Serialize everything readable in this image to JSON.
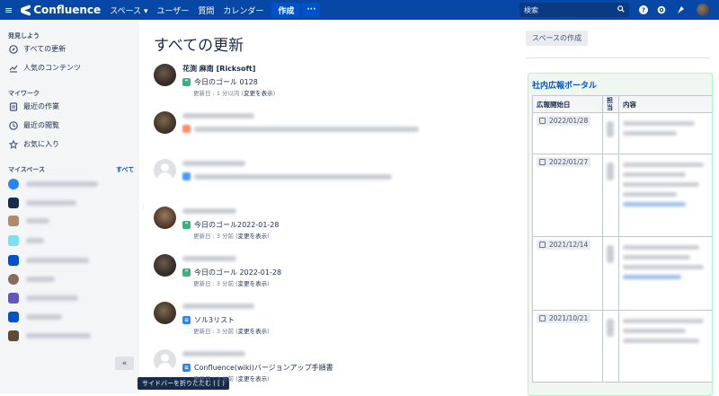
{
  "topbar": {
    "menu_icon": "hamburger-icon",
    "app_name": "Confluence",
    "nav": [
      {
        "label": "スペース ▾"
      },
      {
        "label": "ユーザー"
      },
      {
        "label": "質問"
      },
      {
        "label": "カレンダー"
      }
    ],
    "create_label": "作成",
    "more_label": "···",
    "search_placeholder": "検索",
    "icons": [
      "help-icon",
      "settings-icon",
      "notifications-icon"
    ]
  },
  "sidebar": {
    "discover_heading": "発見しよう",
    "discover_items": [
      {
        "label": "すべての更新",
        "icon": "compass-icon"
      },
      {
        "label": "人気のコンテンツ",
        "icon": "chart-icon"
      }
    ],
    "mywork_heading": "マイワーク",
    "mywork_items": [
      {
        "label": "最近の作業",
        "icon": "document-icon"
      },
      {
        "label": "最近の閲覧",
        "icon": "clock-icon"
      },
      {
        "label": "お気に入り",
        "icon": "star-icon"
      }
    ],
    "myspaces_heading": "マイスペース",
    "all_link": "すべて",
    "collapse_label": "«",
    "collapse_tooltip": "サイドバーを折りたたむ ( [ )"
  },
  "main": {
    "title": "すべての更新",
    "feed": [
      {
        "author": "花渕 麻南 [Ricksoft]",
        "title": "今日のゴール 0128",
        "meta_prefix": "更新日 : 1 分以内 (",
        "meta_link": "変更を表示",
        "meta_suffix": ")",
        "type": "quote"
      },
      {
        "author": "",
        "title": "",
        "meta_prefix": "",
        "meta_link": "",
        "meta_suffix": "",
        "type": "blur"
      },
      {
        "author": "",
        "title": "",
        "meta_prefix": "",
        "meta_link": "",
        "meta_suffix": "",
        "type": "blueblur"
      },
      {
        "author": "",
        "title": "今日のゴール2022-01-28",
        "meta_prefix": "更新日 : 3 分前 (",
        "meta_link": "変更を表示",
        "meta_suffix": ")",
        "type": "quote"
      },
      {
        "author": "",
        "title": "今日のゴール 2022-01-28",
        "meta_prefix": "更新日 : 3 分前 (",
        "meta_link": "変更を表示",
        "meta_suffix": ")",
        "type": "quote"
      },
      {
        "author": "",
        "title": "ソル3リスト",
        "meta_prefix": "更新日 : 3 分前 (",
        "meta_link": "変更を表示",
        "meta_suffix": ")",
        "type": "page"
      },
      {
        "author": "",
        "title": "Confluence(wiki)バージョンアップ手順書",
        "meta_prefix": "更新日 : 3 分前 (",
        "meta_link": "変更を表示",
        "meta_suffix": ")",
        "type": "page"
      }
    ],
    "create_space_label": "スペースの作成",
    "portal": {
      "title": "社内広報ポータル",
      "headers": [
        "広報開始日",
        "担当",
        "内容"
      ],
      "dates": [
        "2022/01/28",
        "2022/01/27",
        "2021/12/14",
        "2021/10/21"
      ]
    }
  }
}
